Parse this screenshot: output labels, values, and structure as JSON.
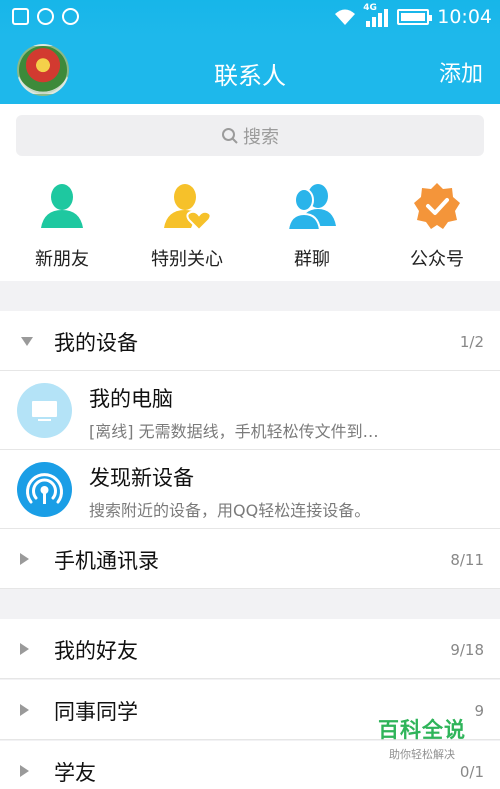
{
  "status_bar": {
    "network": "4G",
    "time": "10:04"
  },
  "header": {
    "title": "联系人",
    "add_label": "添加"
  },
  "search": {
    "placeholder": "搜索"
  },
  "quick_entries": [
    {
      "label": "新朋友",
      "icon": "person-icon",
      "color": "#1ec8a0"
    },
    {
      "label": "特别关心",
      "icon": "heart-person-icon",
      "color": "#f6c12a"
    },
    {
      "label": "群聊",
      "icon": "group-icon",
      "color": "#2ab4ea"
    },
    {
      "label": "公众号",
      "icon": "badge-check-icon",
      "color": "#f4953a"
    }
  ],
  "device_group": {
    "name": "我的设备",
    "count": "1/2",
    "expanded": true,
    "items": [
      {
        "title": "我的电脑",
        "subtitle": "[离线] 无需数据线，手机轻松传文件到…",
        "icon": "computer-icon",
        "color": "#b4e3f7"
      },
      {
        "title": "发现新设备",
        "subtitle": "搜索附近的设备，用QQ轻松连接设备。",
        "icon": "radar-icon",
        "color": "#1a9ee6"
      }
    ]
  },
  "contacts_group": {
    "name": "手机通讯录",
    "count": "8/11"
  },
  "friend_groups": [
    {
      "name": "我的好友",
      "count": "9/18"
    },
    {
      "name": "同事同学",
      "count": "9"
    },
    {
      "name": "学友",
      "count": "0/1"
    }
  ],
  "watermark": {
    "title": "百科全说",
    "subtitle": "助你轻松解决"
  },
  "colors": {
    "accent": "#1eb8eb",
    "background": "#f2f2f4"
  }
}
